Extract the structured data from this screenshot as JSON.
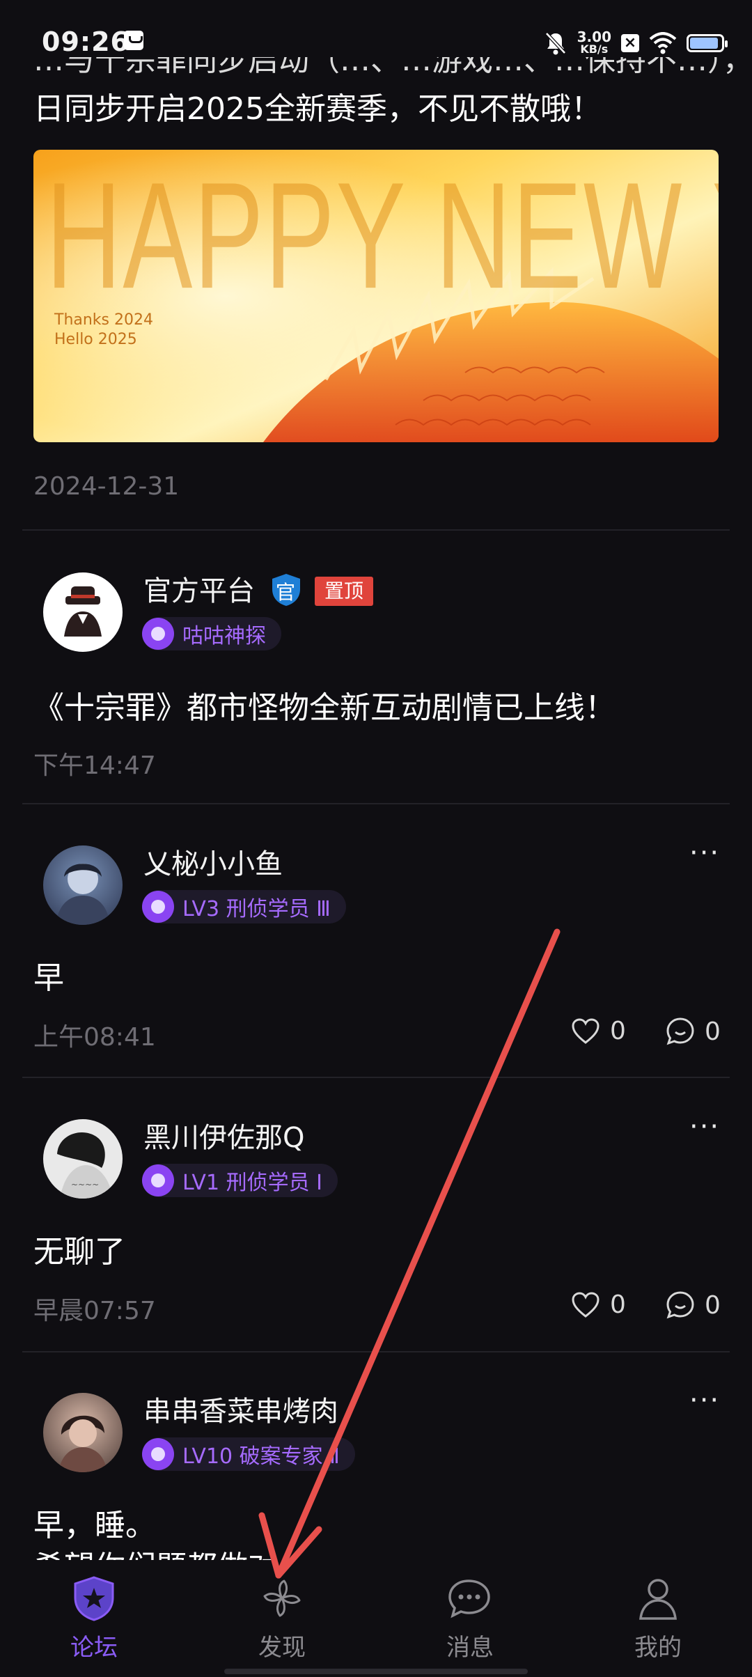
{
  "status_bar": {
    "time": "09:26",
    "speed_value": "3.00",
    "speed_unit": "KB/s",
    "battery_level": 0.84
  },
  "intro": {
    "line1_partial": "…与十宗罪同步启动（…、…游戏…、…保持不…），…",
    "line2": "日同步开启2025全新赛季，不见不散哦！",
    "banner": {
      "title": "HAPPY NEW YEAR",
      "sub1": "Thanks 2024",
      "sub2": "Hello 2025"
    },
    "date": "2024-12-31"
  },
  "posts": [
    {
      "username": "官方平台",
      "official_badge": "官",
      "pinned_label": "置顶",
      "badge": "咕咕神探",
      "text": "《十宗罪》都市怪物全新互动剧情已上线！",
      "time": "下午14:47"
    },
    {
      "username": "乂柲小小鱼",
      "badge": "LV3 刑侦学员 Ⅲ",
      "text": "早",
      "time": "上午08:41",
      "likes": "0",
      "comments": "0"
    },
    {
      "username": "黑川伊佐那Q",
      "badge": "LV1 刑侦学员 Ⅰ",
      "text": "无聊了",
      "time": "早晨07:57",
      "likes": "0",
      "comments": "0"
    },
    {
      "username": "串串香菜串烤肉",
      "badge": "LV10 破案专家 Ⅱ",
      "text": "早，睡。",
      "text2": "希望你们题都做对"
    }
  ],
  "more_symbol": "···",
  "tabs": [
    {
      "label": "论坛",
      "icon": "shield-star-icon",
      "active": true
    },
    {
      "label": "发现",
      "icon": "pinwheel-icon",
      "active": false
    },
    {
      "label": "消息",
      "icon": "chat-bubble-icon",
      "active": false
    },
    {
      "label": "我的",
      "icon": "person-icon",
      "active": false
    }
  ],
  "colors": {
    "background": "#0f0e12",
    "accent": "#8a5cf5",
    "badge_text": "#a66bff",
    "pin_red": "#e0443c",
    "arrow_red": "#e8504c"
  }
}
